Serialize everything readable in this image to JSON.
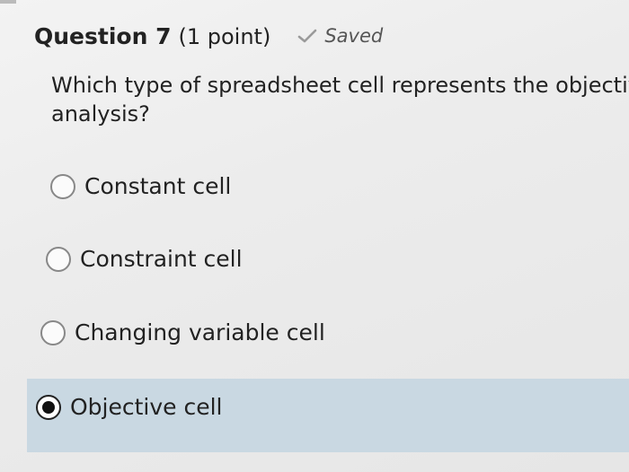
{
  "question": {
    "title": "Question 7",
    "points": "(1 point)",
    "status": "Saved",
    "text_line1": "Which type of spreadsheet cell represents the objectiv",
    "text_line2": "analysis?"
  },
  "options": [
    {
      "label": "Constant cell",
      "selected": false
    },
    {
      "label": "Constraint cell",
      "selected": false
    },
    {
      "label": "Changing variable cell",
      "selected": false
    },
    {
      "label": "Objective cell",
      "selected": true
    }
  ],
  "colors": {
    "selected_band": "#c9d8e2",
    "check_mark": "#9a9a9a"
  },
  "icons": {
    "status": "check-icon",
    "radio_selected": "radio-checked-icon",
    "radio_unselected": "radio-unchecked-icon"
  }
}
